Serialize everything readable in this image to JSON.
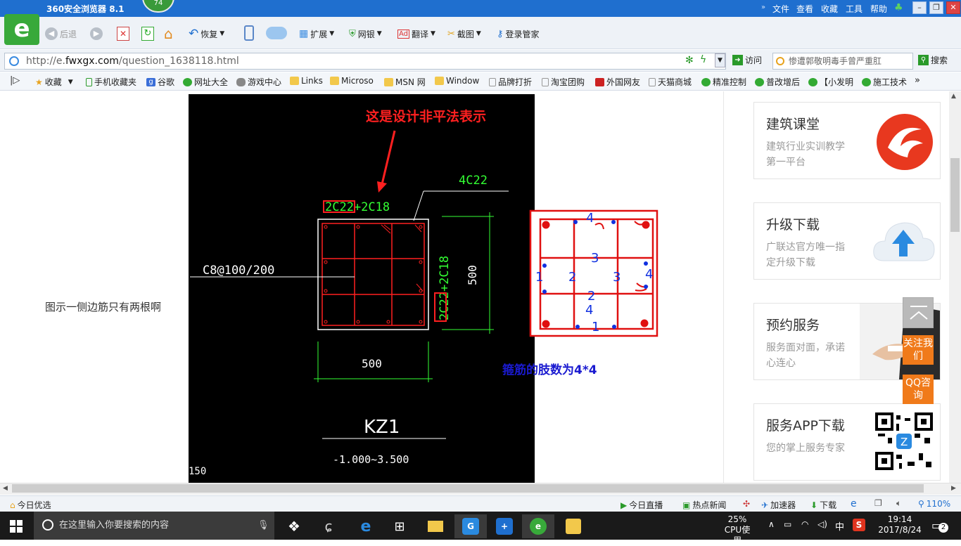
{
  "titlebar": {
    "app_name": "360安全浏览器 8.1",
    "badge": "74",
    "menu": [
      "文件",
      "查看",
      "收藏",
      "工具",
      "帮助"
    ]
  },
  "toolbar": {
    "back_label": "后退",
    "restore_label": "恢复",
    "ext_label": "扩展",
    "bank_label": "网银",
    "translate_label": "翻译",
    "screenshot_label": "截图",
    "login_label": "登录管家"
  },
  "address": {
    "url_prefix": "http://e.",
    "url_domain": "fwxgx.com",
    "url_path": "/question_1638118.html",
    "go_label": "访问",
    "search_value": "惨遭郭敬明毒手曾严重肛",
    "search_button": "搜索"
  },
  "favorites": [
    "收藏",
    "手机收藏夹",
    "谷歌",
    "网址大全",
    "游戏中心",
    "Links",
    "Microso",
    "MSN 网",
    "Window",
    "品牌打折",
    "淘宝团购",
    "外国网友",
    "天猫商城",
    "精准控制",
    "普改增后",
    "【小发明",
    "施工技术"
  ],
  "question_text": "图示一侧边筋只有两根啊",
  "cad": {
    "annotation": "这是设计非平法表示",
    "label_4c22": "4C22",
    "label_top": "2C22+2C18",
    "label_side": "2C22+2C18",
    "label_stirrup": "C8@100/200",
    "dim_height": "500",
    "dim_width": "500",
    "column_name": "KZ1",
    "elevation": "-1.000~3.500",
    "corner_text": "150",
    "limb_numbers": [
      "4",
      "3",
      "1",
      "2",
      "3",
      "4",
      "2",
      "1"
    ],
    "caption": "箍筋的肢数为4*4"
  },
  "sidebar": [
    {
      "title": "建筑课堂",
      "subtitle": "建筑行业实训教学第一平台"
    },
    {
      "title": "升级下载",
      "subtitle": "广联达官方唯一指定升级下载"
    },
    {
      "title": "预约服务",
      "subtitle": "服务面对面，承诺心连心"
    },
    {
      "title": "服务APP下载",
      "subtitle": "您的掌上服务专家"
    }
  ],
  "float_buttons": {
    "follow": "关注我们",
    "qq": "QQ咨询"
  },
  "statusbar": {
    "today_picks": "今日优选",
    "today_live": "今日直播",
    "hot_news": "热点新闻",
    "accelerator": "加速器",
    "download": "下载",
    "zoom": "110%"
  },
  "taskbar": {
    "search_placeholder": "在这里输入你要搜索的内容",
    "cpu_percent": "25%",
    "cpu_label": "CPU使用",
    "ime": "中",
    "time": "19:14",
    "date": "2017/8/24",
    "notifications": "2"
  }
}
